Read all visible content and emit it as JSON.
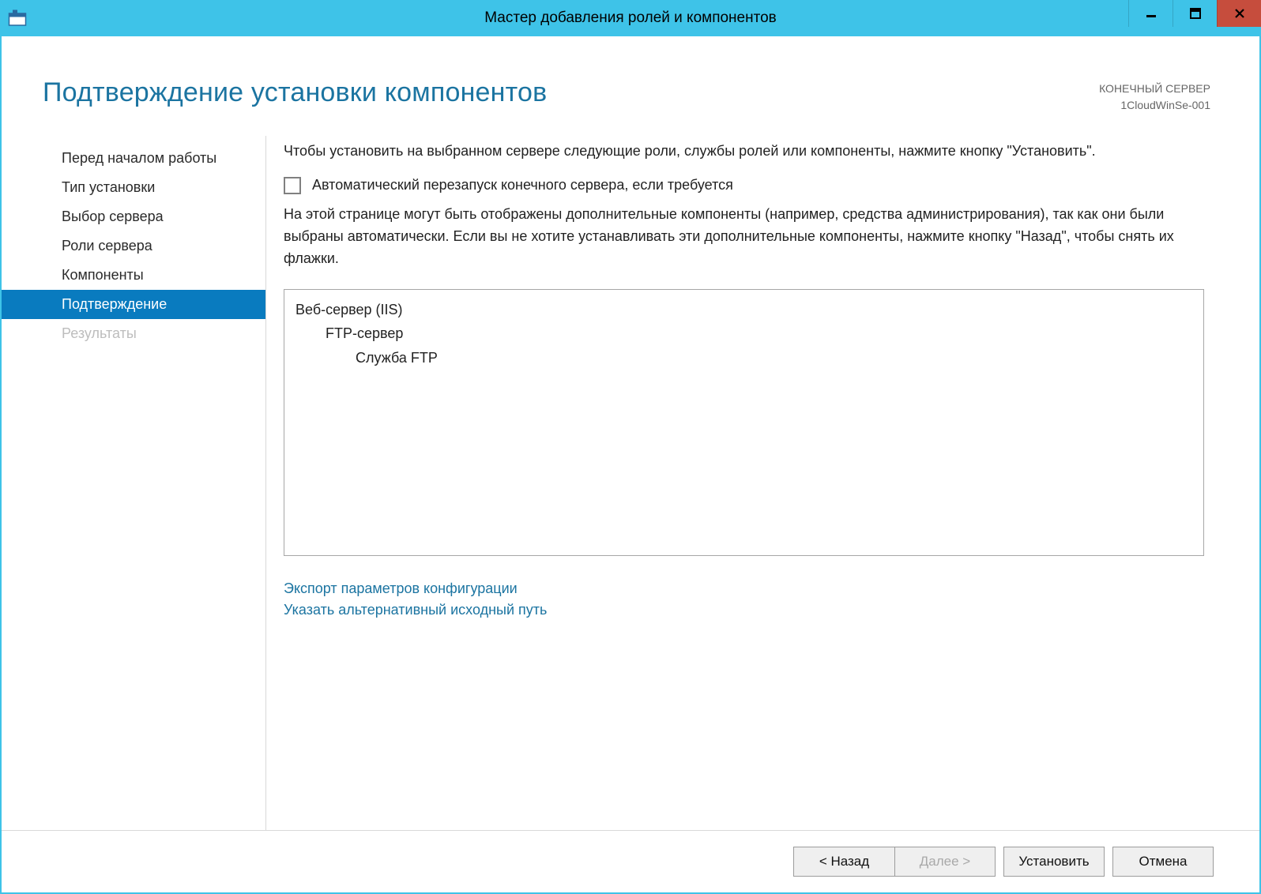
{
  "window": {
    "title": "Мастер добавления ролей и компонентов"
  },
  "header": {
    "page_title": "Подтверждение установки компонентов",
    "target_label": "КОНЕЧНЫЙ СЕРВЕР",
    "target_server": "1CloudWinSe-001"
  },
  "sidebar": {
    "items": [
      {
        "label": "Перед началом работы",
        "state": "normal"
      },
      {
        "label": "Тип установки",
        "state": "normal"
      },
      {
        "label": "Выбор сервера",
        "state": "normal"
      },
      {
        "label": "Роли сервера",
        "state": "normal"
      },
      {
        "label": "Компоненты",
        "state": "normal"
      },
      {
        "label": "Подтверждение",
        "state": "active"
      },
      {
        "label": "Результаты",
        "state": "disabled"
      }
    ]
  },
  "main": {
    "intro": "Чтобы установить на выбранном сервере следующие роли, службы ролей или компоненты, нажмите кнопку \"Установить\".",
    "restart_checkbox_label": "Автоматический перезапуск конечного сервера, если требуется",
    "note": "На этой странице могут быть отображены дополнительные компоненты (например, средства администрирования), так как они были выбраны автоматически. Если вы не хотите устанавливать эти дополнительные компоненты, нажмите кнопку \"Назад\", чтобы снять их флажки.",
    "features": [
      {
        "label": "Веб-сервер (IIS)",
        "indent": 0
      },
      {
        "label": "FTP-сервер",
        "indent": 1
      },
      {
        "label": "Служба FTP",
        "indent": 2
      }
    ],
    "links": {
      "export": "Экспорт параметров конфигурации",
      "alt_source": "Указать альтернативный исходный путь"
    }
  },
  "footer": {
    "back": "< Назад",
    "next": "Далее >",
    "install": "Установить",
    "cancel": "Отмена"
  }
}
